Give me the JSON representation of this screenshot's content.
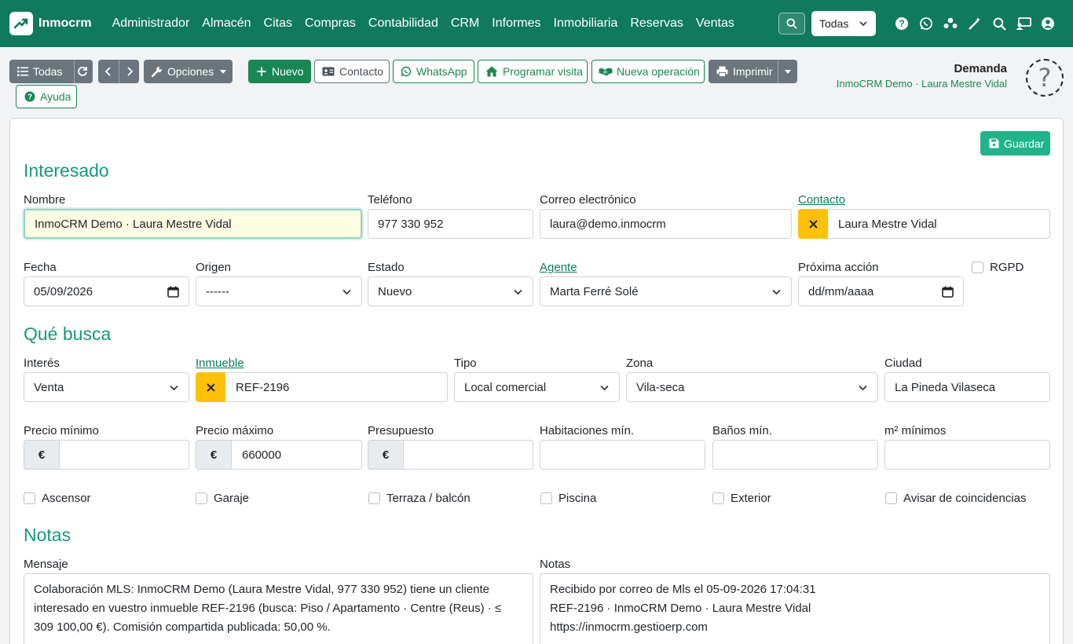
{
  "nav": {
    "app_name": "Inmocrm",
    "menu": [
      "Administrador",
      "Almacén",
      "Citas",
      "Compras",
      "Contabilidad",
      "CRM",
      "Informes",
      "Inmobiliaria",
      "Reservas",
      "Ventas"
    ],
    "scope_select": "Todas",
    "icons": [
      "search-icon",
      "help-icon",
      "whatsapp-icon",
      "users-icon",
      "magic-wand-icon",
      "search-icon",
      "monitor-user-icon",
      "user-icon"
    ]
  },
  "toolbar": {
    "todas": "Todas",
    "opciones": "Opciones",
    "nuevo": "Nuevo",
    "contacto": "Contacto",
    "whatsapp": "WhatsApp",
    "programar": "Programar visita",
    "nueva_operacion": "Nueva operación",
    "imprimir": "Imprimir",
    "ayuda": "Ayuda"
  },
  "header": {
    "title": "Demanda",
    "subtitle": "InmoCRM Demo · Laura Mestre Vidal",
    "avatar": "?"
  },
  "form": {
    "save": "Guardar",
    "interesado": {
      "title": "Interesado",
      "nombre_label": "Nombre",
      "nombre": "InmoCRM Demo · Laura Mestre Vidal",
      "telefono_label": "Teléfono",
      "telefono": "977 330 952",
      "email_label": "Correo electrónico",
      "email": "laura@demo.inmocrm",
      "contacto_label": "Contacto",
      "contacto": "Laura Mestre Vidal",
      "fecha_label": "Fecha",
      "fecha": "05/09/2026",
      "origen_label": "Origen",
      "origen": "------",
      "estado_label": "Estado",
      "estado": "Nuevo",
      "agente_label": "Agente",
      "agente": "Marta Ferré Solé",
      "proxima_label": "Próxima acción",
      "proxima": "dd/mm/aaaa",
      "rgpd_label": "RGPD"
    },
    "busca": {
      "title": "Qué busca",
      "interes_label": "Interés",
      "interes": "Venta",
      "inmueble_label": "Inmueble",
      "inmueble": "REF-2196",
      "tipo_label": "Tipo",
      "tipo": "Local comercial",
      "zona_label": "Zona",
      "zona": "Vila-seca",
      "ciudad_label": "Ciudad",
      "ciudad": "La Pineda Vilaseca",
      "precio_min_label": "Precio mínimo",
      "precio_min": "",
      "precio_max_label": "Precio máximo",
      "precio_max": "660000",
      "presupuesto_label": "Presupuesto",
      "presupuesto": "",
      "hab_label": "Habitaciones mín.",
      "banos_label": "Baños mín.",
      "m2_label": "m² mínimos",
      "currency": "€",
      "checks": [
        "Ascensor",
        "Garaje",
        "Terraza / balcón",
        "Piscina",
        "Exterior",
        "Avisar de coincidencias"
      ]
    },
    "notas": {
      "title": "Notas",
      "mensaje_label": "Mensaje",
      "mensaje": "Colaboración MLS: InmoCRM Demo (Laura Mestre Vidal, 977 330 952) tiene un cliente interesado en vuestro inmueble REF-2196 (busca: Piso / Apartamento · Centre (Reus) · ≤ 309 100,00 €). Comisión compartida publicada: 50,00 %.",
      "notas_label": "Notas",
      "notas_lines": [
        "Recibido por correo de Mls el 05-09-2026 17:04:31",
        "REF-2196 · InmoCRM Demo · Laura Mestre Vidal",
        "https://inmocrm.gestioerp.com"
      ]
    }
  }
}
